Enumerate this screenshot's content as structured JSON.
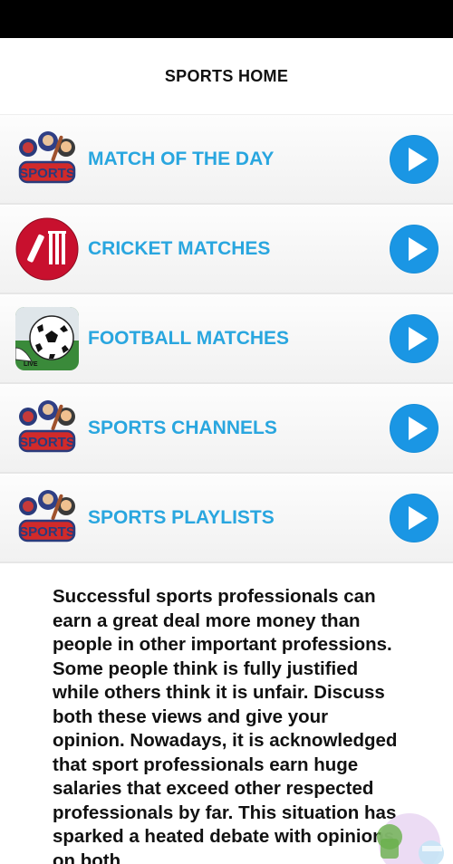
{
  "header": {
    "title": "SPORTS HOME"
  },
  "menu": {
    "items": [
      {
        "label": "MATCH OF THE DAY",
        "thumb": "sports-logo",
        "logo_text": "SPORTS"
      },
      {
        "label": "CRICKET MATCHES",
        "thumb": "cricket-icon"
      },
      {
        "label": "FOOTBALL MATCHES",
        "thumb": "football-icon",
        "badge_text": "LIVE"
      },
      {
        "label": "SPORTS CHANNELS",
        "thumb": "sports-logo",
        "logo_text": "SPORTS"
      },
      {
        "label": "SPORTS PLAYLISTS",
        "thumb": "sports-logo",
        "logo_text": "SPORTS"
      }
    ]
  },
  "description": {
    "text": "Successful sports professionals can earn a great deal more money than people in other important professions. Some people think is fully justified while others think it is unfair. Discuss both these views and give your opinion. Nowadays, it is acknowledged that sport professionals earn huge salaries that exceed other respected professionals by far. This situation has sparked a heated debate with opinions on both"
  },
  "colors": {
    "label": "#29a6df",
    "play_button": "#1a96e4",
    "status_bar": "#000000"
  },
  "icons": {
    "play": "play-icon"
  }
}
